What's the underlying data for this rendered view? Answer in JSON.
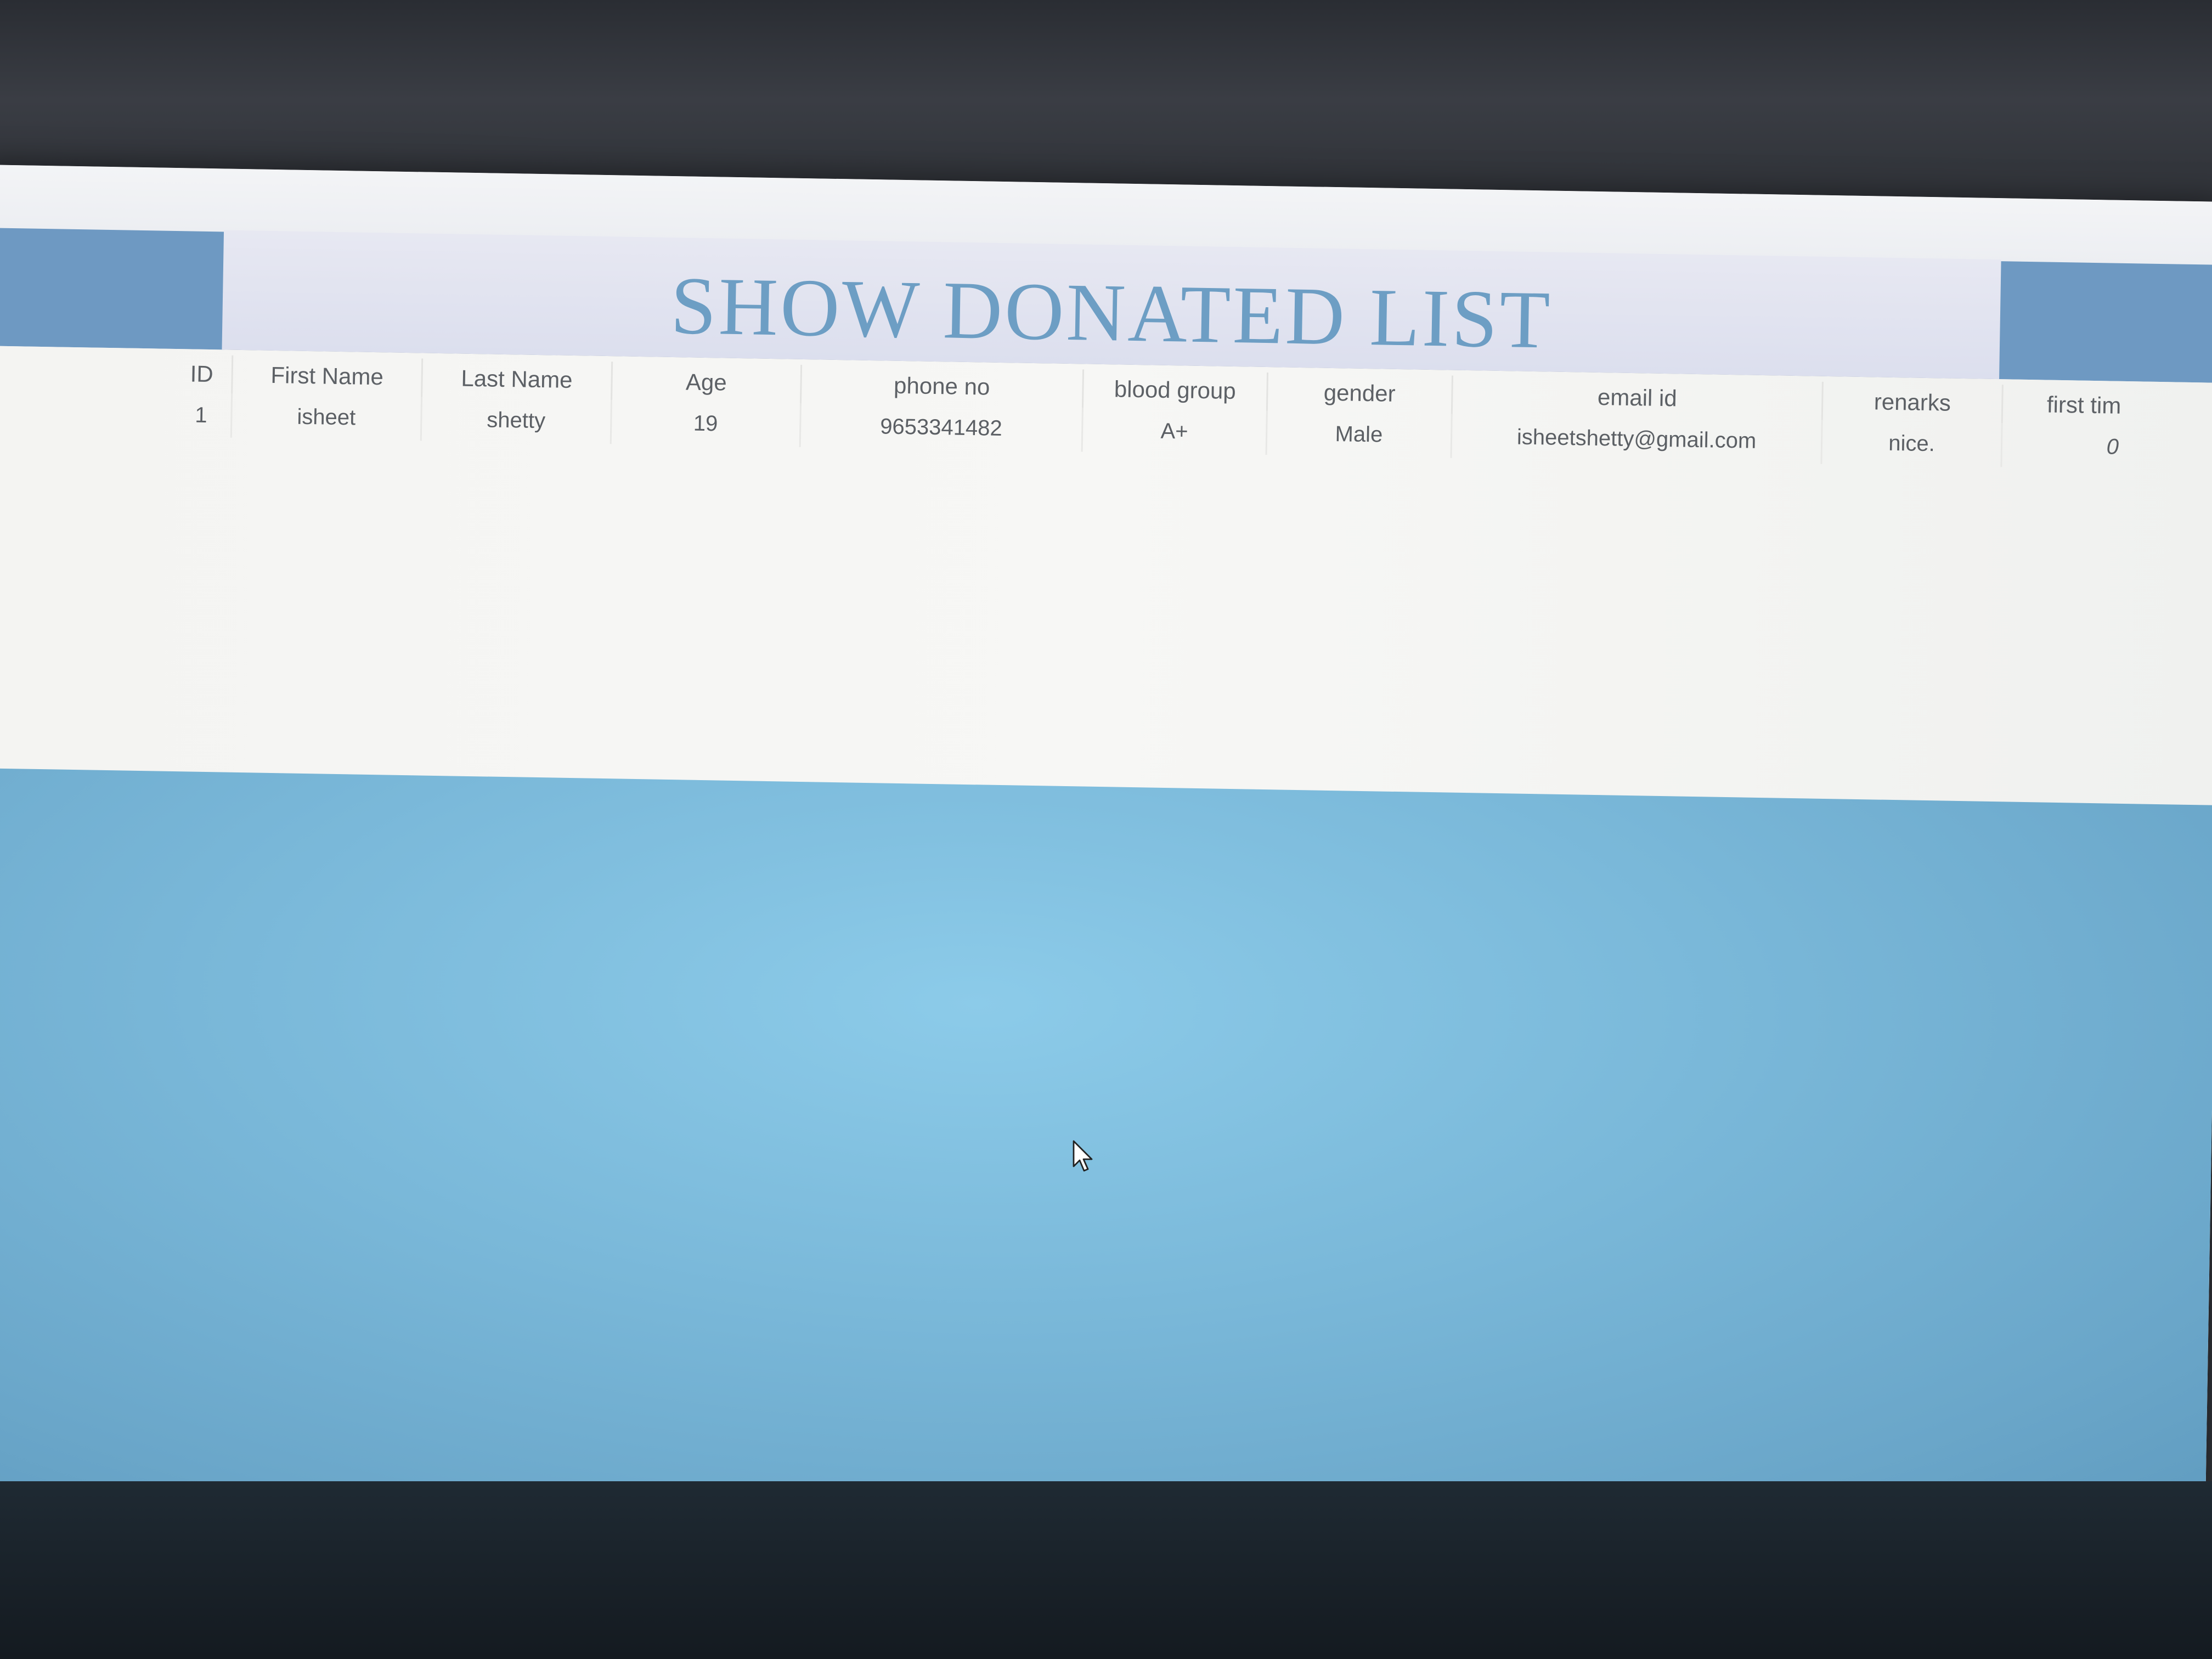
{
  "page": {
    "title": "SHOW DONATED LIST"
  },
  "table": {
    "columns": [
      "ID",
      "First Name",
      "Last Name",
      "Age",
      "phone no",
      "blood group",
      "gender",
      "email id",
      "renarks",
      "first tim"
    ],
    "rows": [
      [
        "1",
        "isheet",
        "shetty",
        "19",
        "9653341482",
        "A+",
        "Male",
        "isheetshetty@gmail.com",
        "nice.",
        "0"
      ]
    ]
  },
  "colors": {
    "title_text": "#6d9ec4",
    "header_band": "#6e99c2",
    "title_panel": "#dcdfee",
    "background_lower": "#79b7d8"
  },
  "icons": {
    "cursor": "mouse-pointer-icon"
  }
}
